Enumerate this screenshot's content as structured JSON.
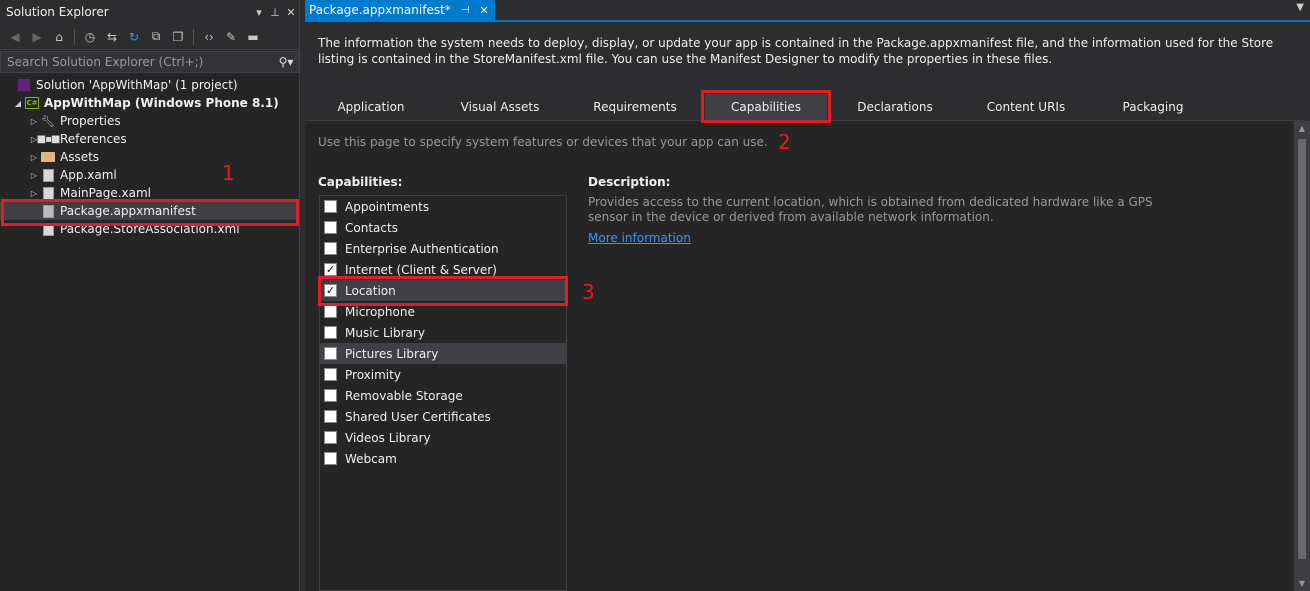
{
  "solution_explorer": {
    "title": "Solution Explorer",
    "search_placeholder": "Search Solution Explorer (Ctrl+;)",
    "tree": [
      {
        "label": "Solution 'AppWithMap' (1 project)",
        "icon": "solution-icon"
      },
      {
        "label": "AppWithMap (Windows Phone 8.1)",
        "icon": "csharp-project-icon",
        "expanded": true
      },
      {
        "label": "Properties",
        "icon": "wrench-icon"
      },
      {
        "label": "References",
        "icon": "references-icon"
      },
      {
        "label": "Assets",
        "icon": "folder-icon"
      },
      {
        "label": "App.xaml",
        "icon": "xaml-file-icon"
      },
      {
        "label": "MainPage.xaml",
        "icon": "xaml-file-icon"
      },
      {
        "label": "Package.appxmanifest",
        "icon": "manifest-file-icon",
        "selected": true
      },
      {
        "label": "Package.StoreAssociation.xml",
        "icon": "xml-file-icon"
      }
    ]
  },
  "document_tab": {
    "label": "Package.appxmanifest*"
  },
  "designer": {
    "intro": "The information the system needs to deploy, display, or update your app is contained in the Package.appxmanifest file, and the information used for the Store listing is contained in the StoreManifest.xml file. You can use the Manifest Designer to modify the properties in these files.",
    "tabs": [
      "Application",
      "Visual Assets",
      "Requirements",
      "Capabilities",
      "Declarations",
      "Content URIs",
      "Packaging"
    ],
    "active_tab": "Capabilities",
    "hint": "Use this page to specify system features or devices that your app can use.",
    "capabilities_label": "Capabilities:",
    "capabilities": [
      {
        "label": "Appointments",
        "checked": false
      },
      {
        "label": "Contacts",
        "checked": false
      },
      {
        "label": "Enterprise Authentication",
        "checked": false
      },
      {
        "label": "Internet (Client & Server)",
        "checked": true
      },
      {
        "label": "Location",
        "checked": true
      },
      {
        "label": "Microphone",
        "checked": false
      },
      {
        "label": "Music Library",
        "checked": false
      },
      {
        "label": "Pictures Library",
        "checked": false,
        "hover": true
      },
      {
        "label": "Proximity",
        "checked": false
      },
      {
        "label": "Removable Storage",
        "checked": false
      },
      {
        "label": "Shared User Certificates",
        "checked": false
      },
      {
        "label": "Videos Library",
        "checked": false
      },
      {
        "label": "Webcam",
        "checked": false
      }
    ],
    "description_label": "Description:",
    "description": "Provides access to the current location, which is obtained from dedicated hardware like a GPS sensor in the device or derived from available network information.",
    "more_info": "More information"
  },
  "annotations": [
    "1",
    "2",
    "3"
  ],
  "colors": {
    "accent": "#007acc",
    "annotation": "#e51c23",
    "link": "#3794ff"
  }
}
